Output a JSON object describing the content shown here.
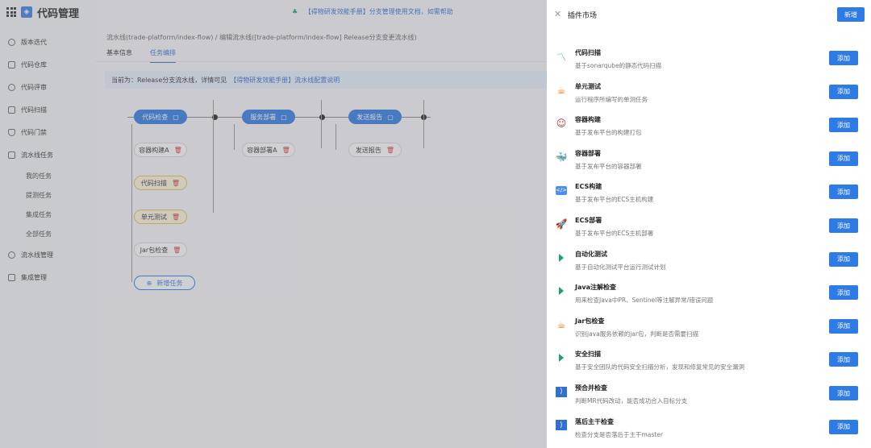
{
  "app": {
    "title": "代码管理"
  },
  "sidebar": {
    "items": [
      {
        "label": "版本迭代",
        "icon": "circle-icon"
      },
      {
        "label": "代码仓库",
        "icon": "list-icon"
      },
      {
        "label": "代码评审",
        "icon": "review-icon"
      },
      {
        "label": "代码扫描",
        "icon": "scan-icon"
      },
      {
        "label": "代码门禁",
        "icon": "shield-icon"
      },
      {
        "label": "流水线任务",
        "icon": "pipeline-icon"
      }
    ],
    "subitems": [
      "我的任务",
      "提测任务",
      "集成任务",
      "全部任务"
    ],
    "bottom_items": [
      {
        "label": "流水线管理",
        "icon": "settings-icon"
      },
      {
        "label": "集成管理",
        "icon": "integration-icon"
      }
    ]
  },
  "topbar": {
    "notice_link": "【得物研发效能手册】",
    "notice_text": "分支管理使用文档，如需帮助"
  },
  "breadcrumb": "流水线(trade-platform/index-flow) / 编辑流水线([trade-platform/index-flow] Release分支变更流水线)",
  "tabs": [
    {
      "label": "基本信息",
      "active": false
    },
    {
      "label": "任务编排",
      "active": true
    }
  ],
  "info": {
    "text": "当前为：Release分支流水线，详情可见",
    "link": "【得物研发效能手册】流水线配置说明"
  },
  "pipeline": {
    "stages": [
      "代码检查",
      "服务部署",
      "发送报告"
    ],
    "col1_jobs": [
      "容器构建A",
      "代码扫描",
      "单元测试",
      "Jar包检查"
    ],
    "col1_add": "新增任务",
    "col2_jobs": [
      "容器部署A"
    ],
    "col3_jobs": [
      "发送报告"
    ]
  },
  "panel": {
    "title": "插件市场",
    "new_label": "新增",
    "add_label": "添加",
    "plugins": [
      {
        "name": "代码扫描",
        "desc": "基于sonarqube的静态代码扫描",
        "icon": "sonar-icon"
      },
      {
        "name": "单元测试",
        "desc": "运行程序所编写的单测任务",
        "icon": "java-icon"
      },
      {
        "name": "容器构建",
        "desc": "基于发布平台的构建打包",
        "icon": "jenkins-icon"
      },
      {
        "name": "容器部署",
        "desc": "基于发布平台的容器部署",
        "icon": "docker-icon"
      },
      {
        "name": "ECS构建",
        "desc": "基于发布平台的ECS主机构建",
        "icon": "code-icon"
      },
      {
        "name": "ECS部署",
        "desc": "基于发布平台的ECS主机部署",
        "icon": "rocket-icon"
      },
      {
        "name": "自动化测试",
        "desc": "基于自动化测试平台运行测试计划",
        "icon": "green-arrow-icon"
      },
      {
        "name": "Java注解检查",
        "desc": "用来检查Java中PR、Sentinel等注解异常/错误问题",
        "icon": "green-arrow-icon"
      },
      {
        "name": "Jar包检查",
        "desc": "识别java服务依赖的jar包，判断是否需要扫描",
        "icon": "java-icon"
      },
      {
        "name": "安全扫描",
        "desc": "基于安全团队的代码安全扫描分析，发现和修复常见的安全漏洞",
        "icon": "green-arrow-icon"
      },
      {
        "name": "预合并检查",
        "desc": "判断MR代码改动，能否成功合入目标分支",
        "icon": "vs-icon"
      },
      {
        "name": "落后主干检查",
        "desc": "检查分支是否落后于主干master",
        "icon": "vs-icon"
      }
    ]
  }
}
